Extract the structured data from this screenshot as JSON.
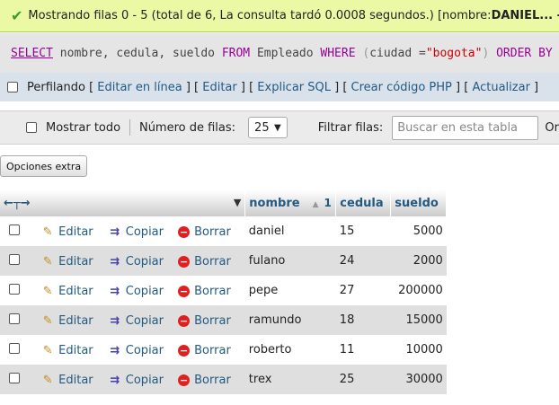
{
  "success": {
    "icon": "check-icon",
    "message": "Mostrando filas 0 - 5 (total de 6, La consulta tardó 0.0008 segundos.) [nombre: ",
    "range": "DANIEL... - TREX...",
    "suffix": "]"
  },
  "sql": {
    "select": "SELECT",
    "cols": " nombre, cedula, sueldo ",
    "from": "FROM",
    "table": " Empleado ",
    "where": "WHERE",
    "open": " (",
    "cond": "ciudad =",
    "value": "\"bogota\"",
    "close": ") ",
    "order": "ORDER BY"
  },
  "profiling": {
    "label": "Perfilando",
    "links": [
      "Editar en línea",
      "Editar",
      "Explicar SQL",
      "Crear código PHP",
      "Actualizar"
    ]
  },
  "navbar": {
    "show_all": "Mostrar todo",
    "rows_label": "Número de filas:",
    "rows_value": "25",
    "filter_label": "Filtrar filas:",
    "filter_placeholder": "Buscar en esta tabla",
    "trailing": "Or"
  },
  "extra_options": "Opciones extra",
  "table": {
    "headers": [
      "nombre",
      "cedula",
      "sueldo"
    ],
    "sort_num": "1",
    "action_labels": {
      "edit": "Editar",
      "copy": "Copiar",
      "delete": "Borrar"
    },
    "rows": [
      {
        "nombre": "daniel",
        "cedula": "15",
        "sueldo": "5000"
      },
      {
        "nombre": "fulano",
        "cedula": "24",
        "sueldo": "2000"
      },
      {
        "nombre": "pepe",
        "cedula": "27",
        "sueldo": "200000"
      },
      {
        "nombre": "ramundo",
        "cedula": "18",
        "sueldo": "15000"
      },
      {
        "nombre": "roberto",
        "cedula": "11",
        "sueldo": "10000"
      },
      {
        "nombre": "trex",
        "cedula": "25",
        "sueldo": "30000"
      }
    ]
  }
}
